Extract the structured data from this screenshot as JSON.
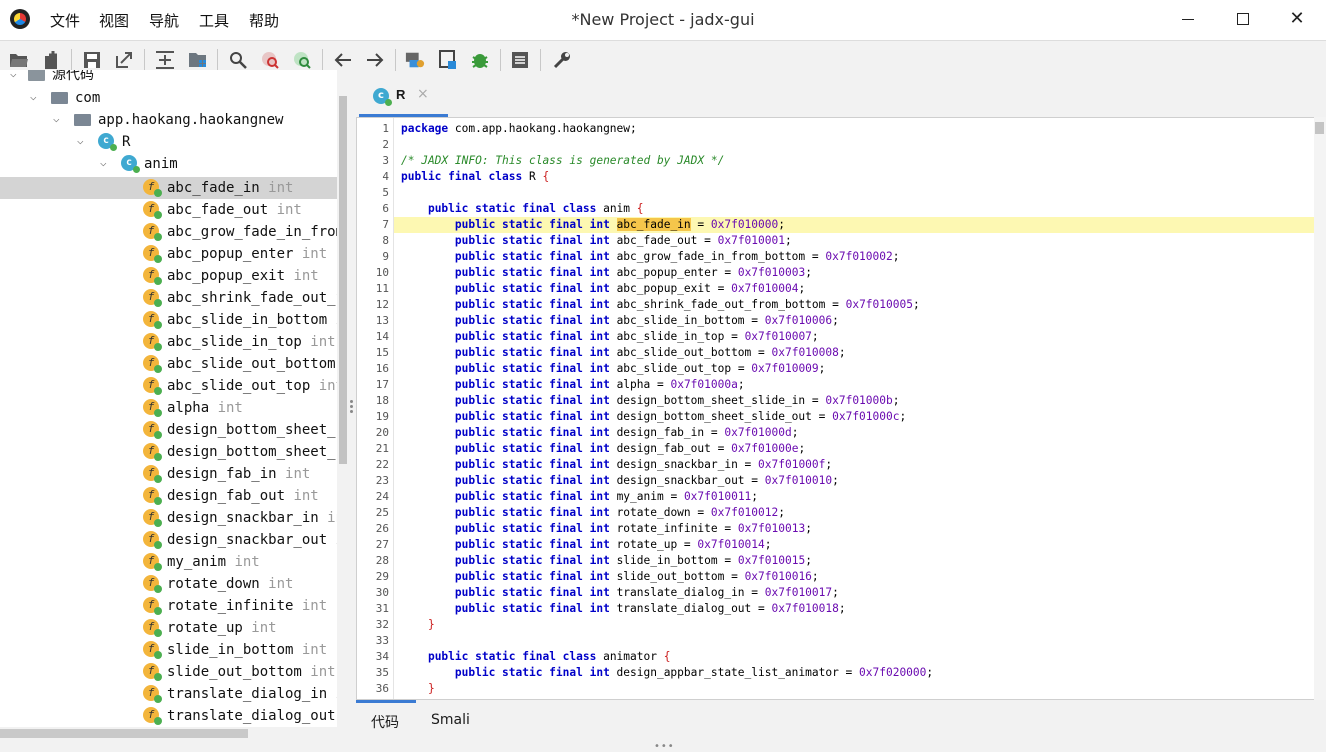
{
  "titlebar": {
    "title": "*New Project - jadx-gui",
    "menus": [
      "文件",
      "视图",
      "导航",
      "工具",
      "帮助"
    ],
    "close_glyph": "✕"
  },
  "toolbar": {
    "icons": [
      "open-folder-icon",
      "add-files-icon",
      "save-icon",
      "export-icon",
      "sync-tree-icon",
      "flat-packages-icon",
      "search-icon",
      "find-class-icon",
      "find-usage-icon",
      "back-icon",
      "forward-icon",
      "decompile-all-icon",
      "mapping-icon",
      "debug-bug-icon",
      "log-viewer-icon",
      "preferences-wrench-icon"
    ]
  },
  "tree": {
    "root_label": "源代码",
    "package": "com",
    "subpackage": "app.haokang.haokangnew",
    "class_name": "R",
    "inner_class": "anim",
    "class_icon_letter": "c",
    "field_icon_letter": "f",
    "fields": [
      {
        "name": "abc_fade_in",
        "type": "int"
      },
      {
        "name": "abc_fade_out",
        "type": "int"
      },
      {
        "name": "abc_grow_fade_in_from",
        "type": ""
      },
      {
        "name": "abc_popup_enter",
        "type": "int"
      },
      {
        "name": "abc_popup_exit",
        "type": "int"
      },
      {
        "name": "abc_shrink_fade_out_f",
        "type": ""
      },
      {
        "name": "abc_slide_in_bottom",
        "type": "i"
      },
      {
        "name": "abc_slide_in_top",
        "type": "int"
      },
      {
        "name": "abc_slide_out_bottom",
        "type": ""
      },
      {
        "name": "abc_slide_out_top",
        "type": "int"
      },
      {
        "name": "alpha",
        "type": "int"
      },
      {
        "name": "design_bottom_sheet_s",
        "type": ""
      },
      {
        "name": "design_bottom_sheet_s",
        "type": ""
      },
      {
        "name": "design_fab_in",
        "type": "int"
      },
      {
        "name": "design_fab_out",
        "type": "int"
      },
      {
        "name": "design_snackbar_in",
        "type": "in"
      },
      {
        "name": "design_snackbar_out",
        "type": "i"
      },
      {
        "name": "my_anim",
        "type": "int"
      },
      {
        "name": "rotate_down",
        "type": "int"
      },
      {
        "name": "rotate_infinite",
        "type": "int"
      },
      {
        "name": "rotate_up",
        "type": "int"
      },
      {
        "name": "slide_in_bottom",
        "type": "int"
      },
      {
        "name": "slide_out_bottom",
        "type": "int"
      },
      {
        "name": "translate_dialog_in",
        "type": "i"
      },
      {
        "name": "translate_dialog_out",
        "type": ""
      }
    ]
  },
  "editor_tab": {
    "icon_letter": "c",
    "label": "R",
    "close_glyph": "×"
  },
  "code": {
    "package_line": "com.app.haokang.haokangnew;",
    "comment": "/* JADX INFO: This class is generated by JADX */",
    "class_name": "R",
    "inner1": "anim",
    "inner2": "animator",
    "fields1": [
      [
        "abc_fade_in",
        "0x7f010000"
      ],
      [
        "abc_fade_out",
        "0x7f010001"
      ],
      [
        "abc_grow_fade_in_from_bottom",
        "0x7f010002"
      ],
      [
        "abc_popup_enter",
        "0x7f010003"
      ],
      [
        "abc_popup_exit",
        "0x7f010004"
      ],
      [
        "abc_shrink_fade_out_from_bottom",
        "0x7f010005"
      ],
      [
        "abc_slide_in_bottom",
        "0x7f010006"
      ],
      [
        "abc_slide_in_top",
        "0x7f010007"
      ],
      [
        "abc_slide_out_bottom",
        "0x7f010008"
      ],
      [
        "abc_slide_out_top",
        "0x7f010009"
      ],
      [
        "alpha",
        "0x7f01000a"
      ],
      [
        "design_bottom_sheet_slide_in",
        "0x7f01000b"
      ],
      [
        "design_bottom_sheet_slide_out",
        "0x7f01000c"
      ],
      [
        "design_fab_in",
        "0x7f01000d"
      ],
      [
        "design_fab_out",
        "0x7f01000e"
      ],
      [
        "design_snackbar_in",
        "0x7f01000f"
      ],
      [
        "design_snackbar_out",
        "0x7f010010"
      ],
      [
        "my_anim",
        "0x7f010011"
      ],
      [
        "rotate_down",
        "0x7f010012"
      ],
      [
        "rotate_infinite",
        "0x7f010013"
      ],
      [
        "rotate_up",
        "0x7f010014"
      ],
      [
        "slide_in_bottom",
        "0x7f010015"
      ],
      [
        "slide_out_bottom",
        "0x7f010016"
      ],
      [
        "translate_dialog_in",
        "0x7f010017"
      ],
      [
        "translate_dialog_out",
        "0x7f010018"
      ]
    ],
    "fields2": [
      [
        "design_appbar_state_list_animator",
        "0x7f020000"
      ]
    ],
    "highlighted_line": 7
  },
  "bottom_tabs": [
    "代码",
    "Smali"
  ]
}
